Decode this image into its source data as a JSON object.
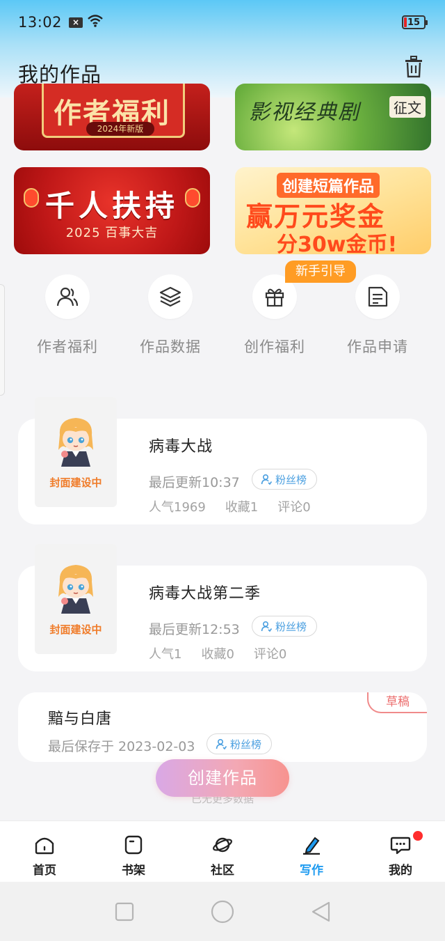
{
  "status_bar": {
    "time": "13:02",
    "battery": "15"
  },
  "page": {
    "title": "我的作品"
  },
  "banners": [
    {
      "text": "作者福利",
      "tag": "2024年新版"
    },
    {
      "text": "影视经典剧",
      "tag": "征文"
    },
    {
      "text": "千人扶持",
      "subtext": "2025 百事大吉"
    },
    {
      "top": "创建短篇作品",
      "mid": "赢万元奖金",
      "low": "分30w金币!"
    }
  ],
  "guide_badge": "新手引导",
  "shortcuts": [
    {
      "label": "作者福利",
      "icon": "author-icon"
    },
    {
      "label": "作品数据",
      "icon": "layers-icon"
    },
    {
      "label": "创作福利",
      "icon": "gift-icon"
    },
    {
      "label": "作品申请",
      "icon": "document-icon"
    }
  ],
  "works": [
    {
      "cover_label": "封面建设中",
      "title": "病毒大战",
      "update": "最后更新10:37",
      "fan_label": "粉丝榜",
      "stats": [
        "人气1969",
        "收藏1",
        "评论0"
      ]
    },
    {
      "cover_label": "封面建设中",
      "title": "病毒大战第二季",
      "update": "最后更新12:53",
      "fan_label": "粉丝榜",
      "stats": [
        "人气1",
        "收藏0",
        "评论0"
      ]
    }
  ],
  "draft": {
    "tag": "草稿",
    "title": "黯与白唐",
    "saved": "最后保存于 2023-02-03",
    "fan_label": "粉丝榜"
  },
  "create_button": "创建作品",
  "hidden_hint": "已无更多数据",
  "tabs": [
    {
      "label": "首页",
      "icon": "home-icon"
    },
    {
      "label": "书架",
      "icon": "bookshelf-icon"
    },
    {
      "label": "社区",
      "icon": "planet-icon"
    },
    {
      "label": "写作",
      "icon": "pen-icon",
      "active": true
    },
    {
      "label": "我的",
      "icon": "chat-icon",
      "badge_dot": true
    }
  ],
  "colors": {
    "accent": "#1e9bf0",
    "orange": "#ff9c24",
    "draft": "#ec6f6f"
  }
}
